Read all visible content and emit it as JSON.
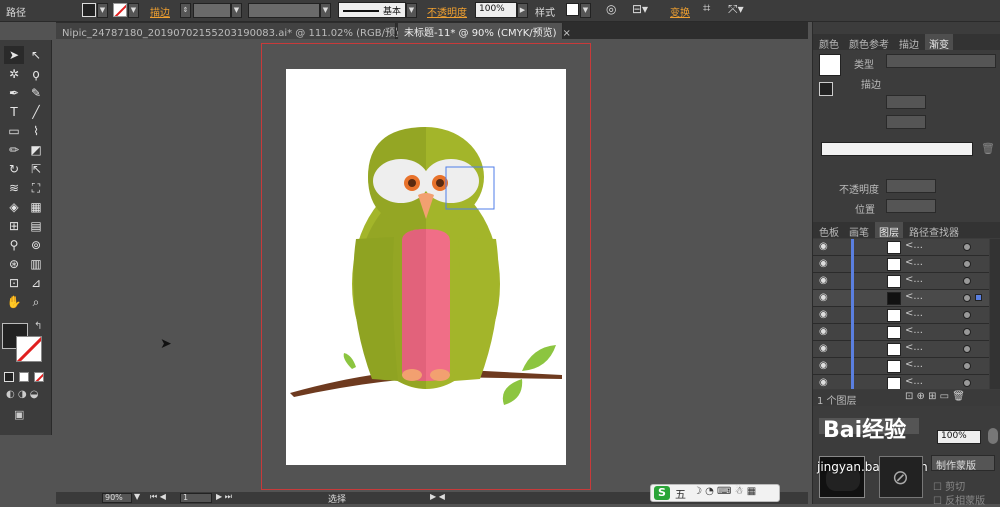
{
  "control_bar": {
    "label_path": "路径",
    "label_stroke": "描边",
    "brush_label": "基本",
    "label_opacity": "不透明度",
    "opacity_value": "100%",
    "label_style": "样式",
    "label_transform": "变换"
  },
  "tabs": [
    {
      "label": "Nipic_24787180_20190702155203190083.ai* @ 111.02% (RGB/预览)"
    },
    {
      "label": "未标题-11* @ 90% (CMYK/预览)"
    }
  ],
  "panels": {
    "top_tabs": [
      "颜色",
      "颜色参考",
      "描边",
      "渐变"
    ],
    "gradient": {
      "label_type": "类型",
      "label_stroke": "描边",
      "label_opacity": "不透明度",
      "label_position": "位置"
    },
    "layer_tabs": [
      "色板",
      "画笔",
      "图层",
      "路径查找器"
    ],
    "layers": [
      {
        "name": "<..."
      },
      {
        "name": "<..."
      },
      {
        "name": "<..."
      },
      {
        "name": "<..."
      },
      {
        "name": "<..."
      },
      {
        "name": "<..."
      },
      {
        "name": "<..."
      },
      {
        "name": "<..."
      },
      {
        "name": "<..."
      }
    ],
    "layer_count": "1 个图层",
    "transparency": {
      "opacity_value": "100%",
      "make_mask_button": "制作蒙版",
      "clip_label": "剪切",
      "invert_label": "反相蒙版"
    },
    "watermark_text": "经验",
    "watermark_url": "jingyan.baidu.com"
  },
  "status_bar": {
    "zoom": "90%",
    "page": "1",
    "tool_name": "选择"
  },
  "ime_bar": {
    "logo": "S",
    "mode": "五"
  },
  "colors": {
    "owl_green": "#a3b52a",
    "owl_green_dark": "#7f921c",
    "owl_belly": "#f06e87",
    "branch": "#6e3a1f",
    "leaf": "#8cc540",
    "bleed_line": "#c83a3a",
    "layer_blue": "#5a7fe0"
  }
}
